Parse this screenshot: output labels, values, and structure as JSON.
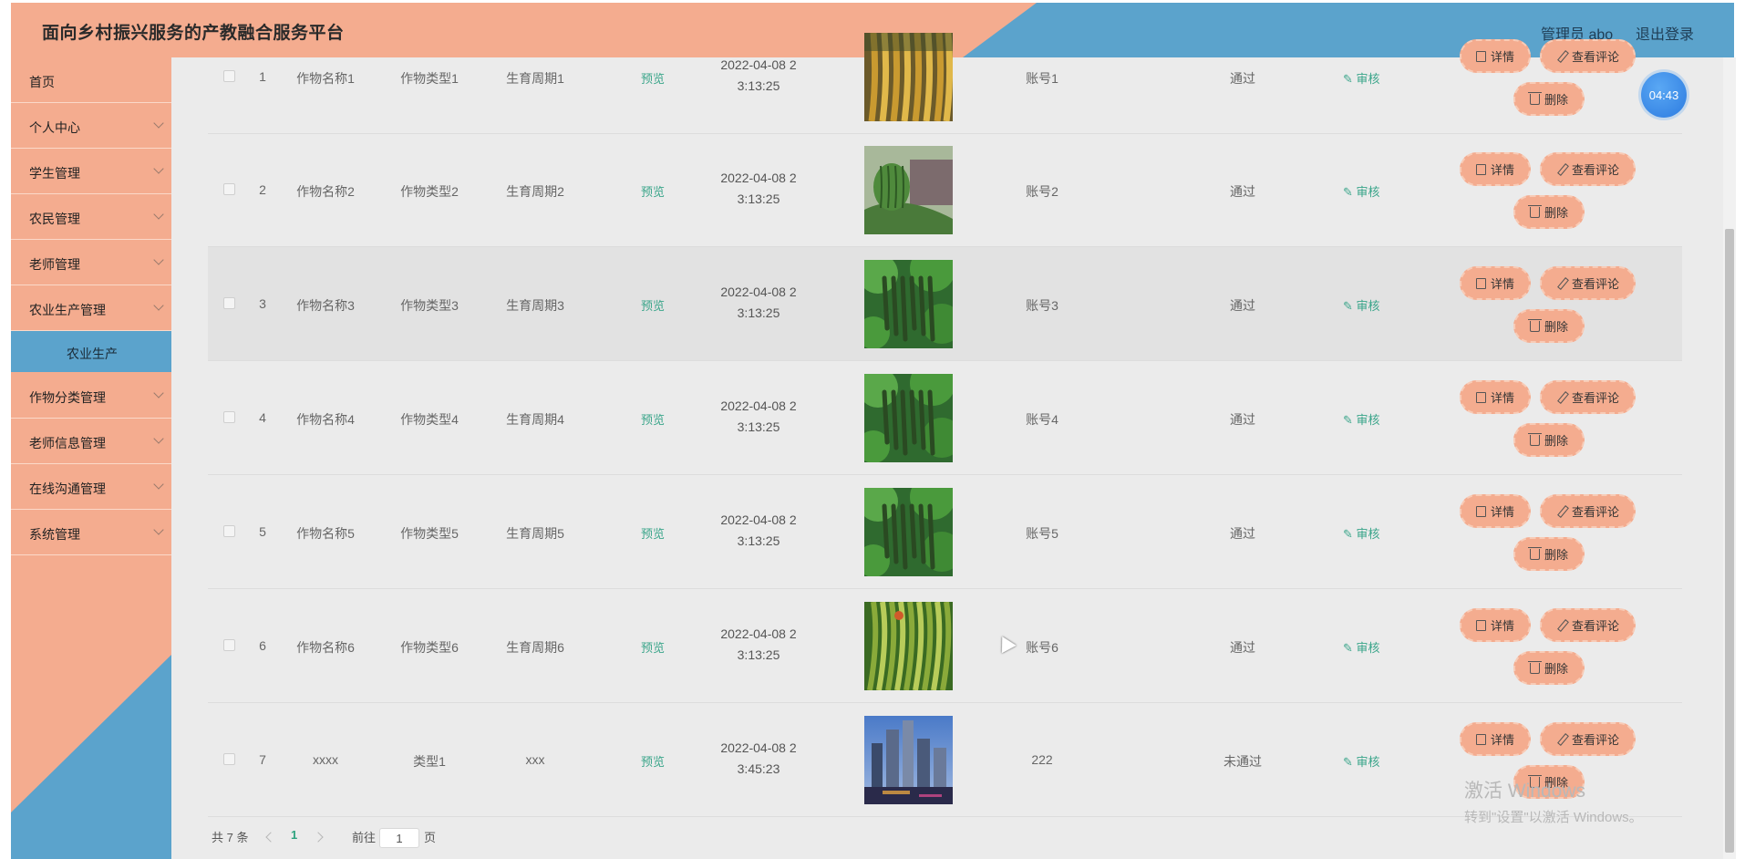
{
  "header": {
    "title": "面向乡村振兴服务的产教融合服务平台",
    "user": "管理员 abo",
    "logout": "退出登录"
  },
  "sidebar": {
    "items": [
      {
        "label": "首页",
        "expandable": false
      },
      {
        "label": "个人中心",
        "expandable": true
      },
      {
        "label": "学生管理",
        "expandable": true
      },
      {
        "label": "农民管理",
        "expandable": true
      },
      {
        "label": "老师管理",
        "expandable": true
      },
      {
        "label": "农业生产管理",
        "expandable": true
      },
      {
        "label": "农业生产",
        "expandable": false,
        "active": true
      },
      {
        "label": "作物分类管理",
        "expandable": true
      },
      {
        "label": "老师信息管理",
        "expandable": true
      },
      {
        "label": "在线沟通管理",
        "expandable": true
      },
      {
        "label": "系统管理",
        "expandable": true
      }
    ]
  },
  "table": {
    "preview_label": "预览",
    "audit_label": "审核",
    "detail_label": "详情",
    "review_label": "查看评论",
    "delete_label": "删除",
    "rows": [
      {
        "index": "1",
        "name": "作物名称1",
        "type": "作物类型1",
        "cycle": "生育周期1",
        "date_line1": "2022-04-08 2",
        "date_line2": "3:13:25",
        "account": "账号1",
        "status": "通过",
        "image": "golden-rice",
        "highlighted": false
      },
      {
        "index": "2",
        "name": "作物名称2",
        "type": "作物类型2",
        "cycle": "生育周期2",
        "date_line1": "2022-04-08 2",
        "date_line2": "3:13:25",
        "account": "账号2",
        "status": "通过",
        "image": "watermelon",
        "highlighted": false
      },
      {
        "index": "3",
        "name": "作物名称3",
        "type": "作物类型3",
        "cycle": "生育周期3",
        "date_line1": "2022-04-08 2",
        "date_line2": "3:13:25",
        "account": "账号3",
        "status": "通过",
        "image": "beans",
        "highlighted": true
      },
      {
        "index": "4",
        "name": "作物名称4",
        "type": "作物类型4",
        "cycle": "生育周期4",
        "date_line1": "2022-04-08 2",
        "date_line2": "3:13:25",
        "account": "账号4",
        "status": "通过",
        "image": "beans",
        "highlighted": false
      },
      {
        "index": "5",
        "name": "作物名称5",
        "type": "作物类型5",
        "cycle": "生育周期5",
        "date_line1": "2022-04-08 2",
        "date_line2": "3:13:25",
        "account": "账号5",
        "status": "通过",
        "image": "beans",
        "highlighted": false
      },
      {
        "index": "6",
        "name": "作物名称6",
        "type": "作物类型6",
        "cycle": "生育周期6",
        "date_line1": "2022-04-08 2",
        "date_line2": "3:13:25",
        "account": "账号6",
        "status": "通过",
        "image": "green-rice",
        "highlighted": false
      },
      {
        "index": "7",
        "name": "xxxx",
        "type": "类型1",
        "cycle": "xxx",
        "date_line1": "2022-04-08 2",
        "date_line2": "3:45:23",
        "account": "222",
        "status": "未通过",
        "image": "city",
        "highlighted": false
      }
    ]
  },
  "pagination": {
    "total": "共 7 条",
    "current": "1",
    "goto_prefix": "前往",
    "goto_value": "1",
    "goto_suffix": "页"
  },
  "timer": "04:43",
  "watermark": {
    "line1": "激活 Windows",
    "line2": "转到\"设置\"以激活 Windows。"
  },
  "colors": {
    "salmon": "#f4ac8f",
    "blue": "#5ba3cc",
    "link_green": "#3aa58a"
  }
}
